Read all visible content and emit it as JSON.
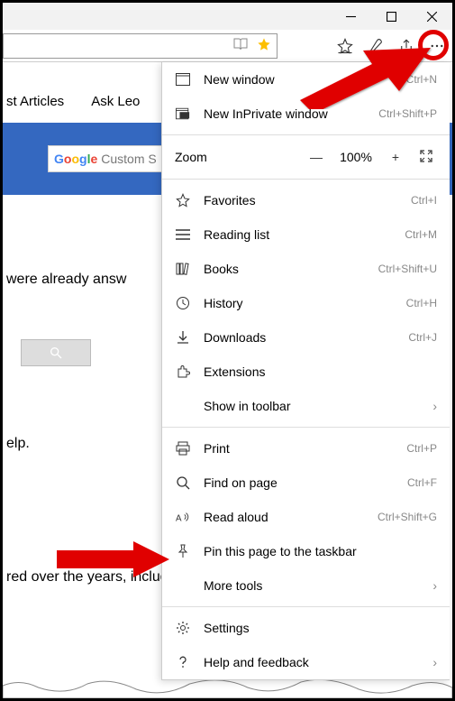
{
  "window": {
    "min": "–",
    "max": "▢",
    "close": "✕"
  },
  "nav": {
    "articles": "st Articles",
    "ask": "Ask Leo"
  },
  "search": {
    "googleLetters": [
      "G",
      "o",
      "o",
      "g",
      "l",
      "e"
    ],
    "placeholder": "Custom S"
  },
  "text": {
    "line1": "were already answ",
    "line2": "elp.",
    "line3": "red over the years, including what I consider to"
  },
  "menu": {
    "newWindow": {
      "label": "New window",
      "shortcut": "Ctrl+N"
    },
    "newPrivate": {
      "label": "New InPrivate window",
      "shortcut": "Ctrl+Shift+P"
    },
    "zoom": {
      "label": "Zoom",
      "value": "100%"
    },
    "favorites": {
      "label": "Favorites",
      "shortcut": "Ctrl+I"
    },
    "reading": {
      "label": "Reading list",
      "shortcut": "Ctrl+M"
    },
    "books": {
      "label": "Books",
      "shortcut": "Ctrl+Shift+U"
    },
    "history": {
      "label": "History",
      "shortcut": "Ctrl+H"
    },
    "downloads": {
      "label": "Downloads",
      "shortcut": "Ctrl+J"
    },
    "extensions": {
      "label": "Extensions"
    },
    "showtoolbar": {
      "label": "Show in toolbar"
    },
    "print": {
      "label": "Print",
      "shortcut": "Ctrl+P"
    },
    "find": {
      "label": "Find on page",
      "shortcut": "Ctrl+F"
    },
    "readaloud": {
      "label": "Read aloud",
      "shortcut": "Ctrl+Shift+G"
    },
    "pin": {
      "label": "Pin this page to the taskbar"
    },
    "moretools": {
      "label": "More tools"
    },
    "settings": {
      "label": "Settings"
    },
    "help": {
      "label": "Help and feedback"
    }
  }
}
